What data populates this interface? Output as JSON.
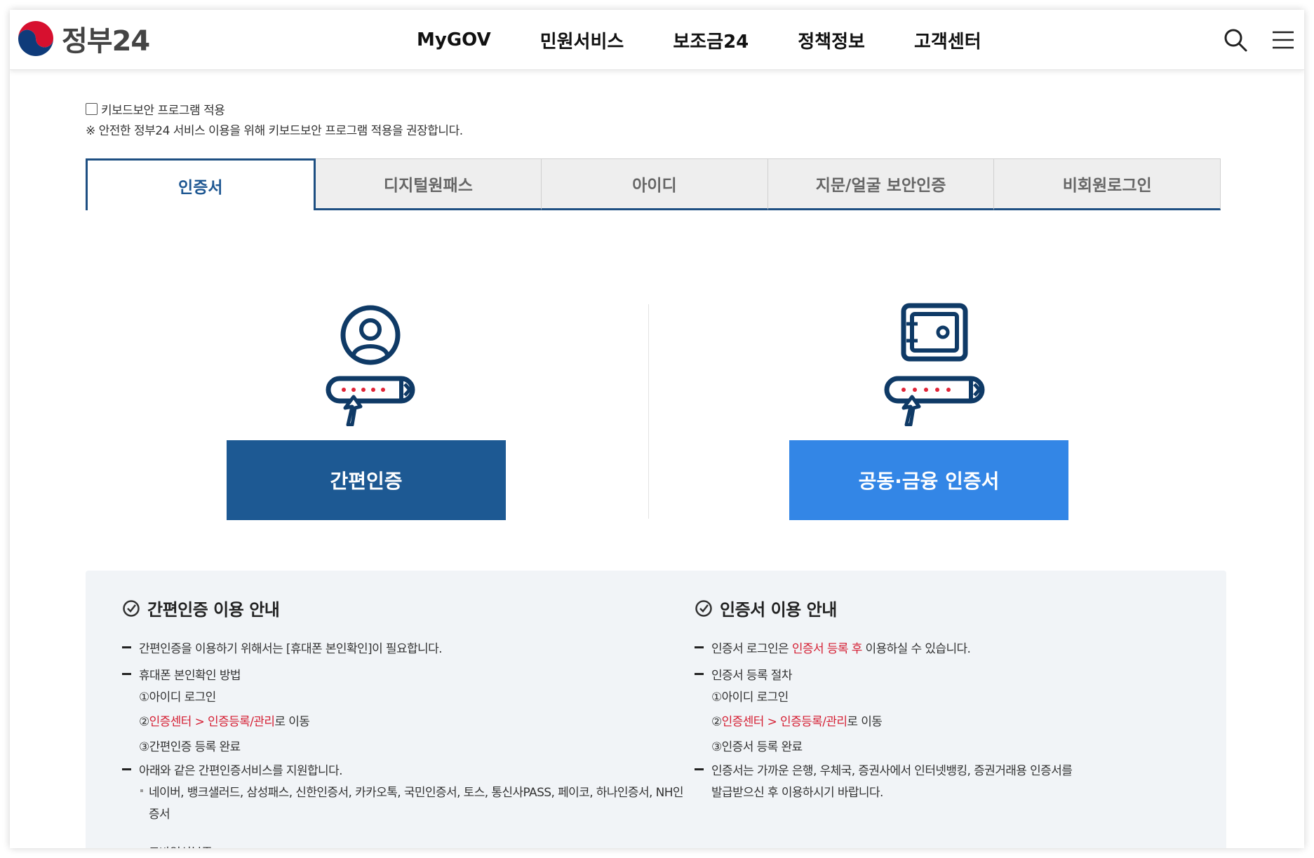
{
  "header": {
    "logo_text": "정부24",
    "nav": [
      "MyGOV",
      "민원서비스",
      "보조금24",
      "정책정보",
      "고객센터"
    ]
  },
  "keyboard_security": {
    "checkbox_label": "키보드보안 프로그램 적용",
    "note": "※ 안전한 정부24 서비스 이용을 위해 키보드보안 프로그램 적용을 권장합니다."
  },
  "tabs": [
    {
      "label": "인증서",
      "active": true
    },
    {
      "label": "디지털원패스",
      "active": false
    },
    {
      "label": "아이디",
      "active": false
    },
    {
      "label": "지문/얼굴 보안인증",
      "active": false
    },
    {
      "label": "비회원로그인",
      "active": false
    }
  ],
  "options": {
    "simple_label": "간편인증",
    "joint_label": "공동·금융 인증서"
  },
  "colors": {
    "primary_dark": "#1d5993",
    "primary_light": "#3386e6",
    "highlight_red": "#d51f33"
  },
  "guide": {
    "left": {
      "title": "간편인증 이용 안내",
      "line1": "간편인증을 이용하기 위해서는 [휴대폰 본인확인]이 필요합니다.",
      "line2": "휴대폰 본인확인 방법",
      "step1": "①아이디 로그인",
      "step2_num": "②",
      "step2_red": "인증센터 > 인증등록/관리",
      "step2_rest": "로 이동",
      "step3": "③간편인증 등록 완료",
      "line3": "아래와 같은 간편인증서비스를 지원합니다.",
      "sub1a": "네이버, 뱅크샐러드, 삼성패스, 신한인증서, 카카오톡, 국민인증서, 토스, 통신사PASS, 페이코, 하나인증서, NH인",
      "sub1b": "증서",
      "sub2": "모바일신분증"
    },
    "right": {
      "title": "인증서 이용 안내",
      "line1_pre": "인증서 로그인은 ",
      "line1_red": "인증서 등록 후",
      "line1_post": " 이용하실 수 있습니다.",
      "line2": "인증서 등록 절차",
      "step1": "①아이디 로그인",
      "step2_num": "②",
      "step2_red": "인증센터 > 인증등록/관리",
      "step2_rest": "로 이동",
      "step3": "③인증서 등록 완료",
      "line3a": "인증서는 가까운 은행, 우체국, 증권사에서 인터넷뱅킹, 증권거래용 인증서를",
      "line3b": "발급받으신 후 이용하시기 바랍니다."
    }
  }
}
